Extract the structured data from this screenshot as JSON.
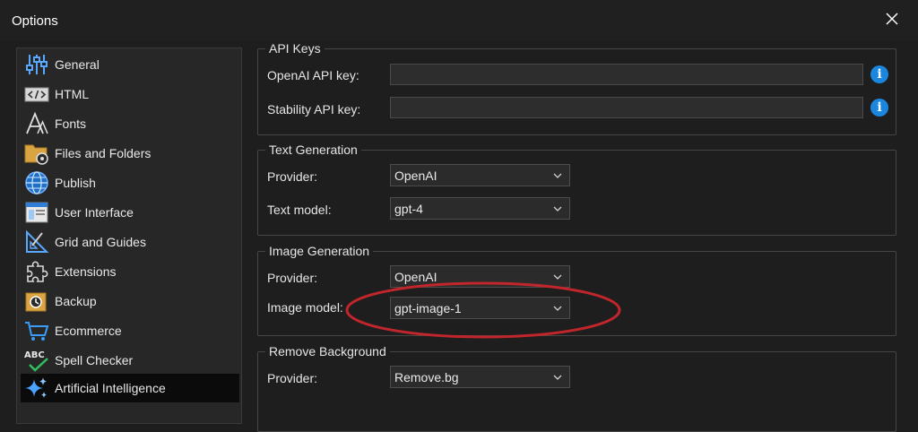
{
  "window": {
    "title": "Options"
  },
  "sidebar": {
    "items": [
      {
        "label": "General",
        "icon": "sliders-icon"
      },
      {
        "label": "HTML",
        "icon": "code-icon"
      },
      {
        "label": "Fonts",
        "icon": "font-icon"
      },
      {
        "label": "Files and Folders",
        "icon": "folder-gear-icon"
      },
      {
        "label": "Publish",
        "icon": "globe-icon"
      },
      {
        "label": "User Interface",
        "icon": "window-icon"
      },
      {
        "label": "Grid and Guides",
        "icon": "ruler-icon"
      },
      {
        "label": "Extensions",
        "icon": "puzzle-icon"
      },
      {
        "label": "Backup",
        "icon": "backup-icon"
      },
      {
        "label": "Ecommerce",
        "icon": "cart-icon"
      },
      {
        "label": "Spell Checker",
        "icon": "spellcheck-icon",
        "icon_text": "ABC"
      },
      {
        "label": "Artificial Intelligence",
        "icon": "sparkle-icon",
        "selected": true
      }
    ]
  },
  "api_keys": {
    "legend": "API Keys",
    "openai_label": "OpenAI API key:",
    "openai_value": "",
    "stability_label": "Stability API key:",
    "stability_value": "",
    "info_glyph": "i"
  },
  "text_generation": {
    "legend": "Text Generation",
    "provider_label": "Provider:",
    "provider_value": "OpenAI",
    "model_label": "Text model:",
    "model_value": "gpt-4"
  },
  "image_generation": {
    "legend": "Image Generation",
    "provider_label": "Provider:",
    "provider_value": "OpenAI",
    "model_label": "Image model:",
    "model_value": "gpt-image-1"
  },
  "remove_background": {
    "legend": "Remove Background",
    "provider_label": "Provider:",
    "provider_value": "Remove.bg"
  },
  "colors": {
    "accent": "#1a86dd",
    "annotation": "#c0262b",
    "selected_item_bg": "#0b0b0b"
  }
}
